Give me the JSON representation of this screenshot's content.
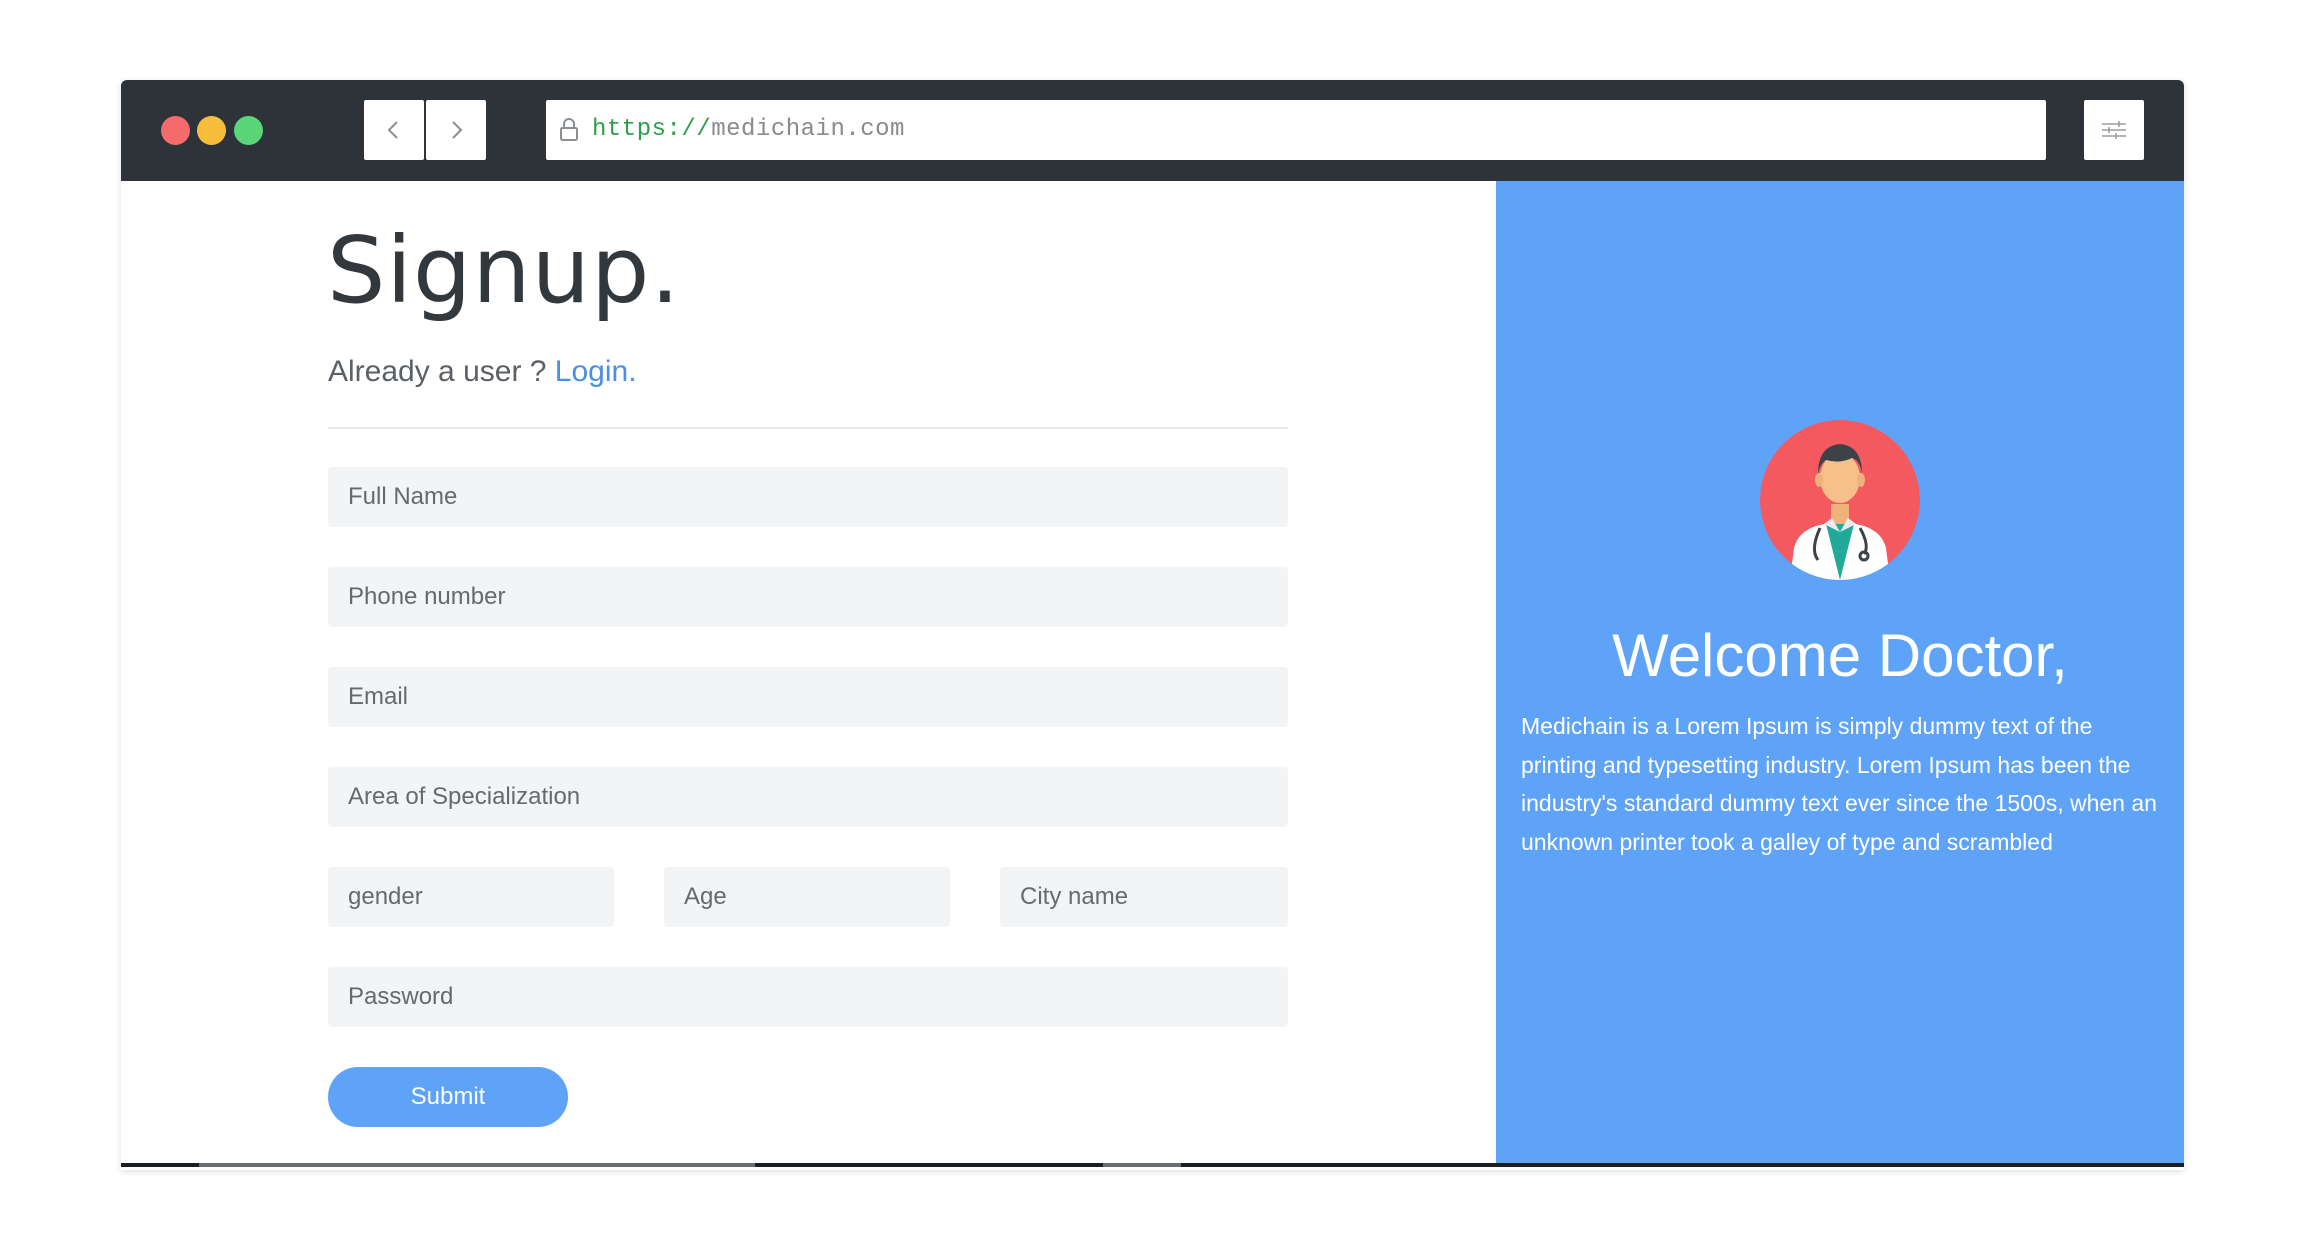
{
  "browser": {
    "url_scheme": "https://",
    "url_host": "medichain.com"
  },
  "signup": {
    "title": "Signup.",
    "already_user": "Already a user ? ",
    "login_link": "Login."
  },
  "form": {
    "full_name_placeholder": "Full Name",
    "phone_placeholder": "Phone number",
    "email_placeholder": "Email",
    "specialization_placeholder": "Area of Specialization",
    "gender_placeholder": "gender",
    "age_placeholder": "Age",
    "city_placeholder": "City name",
    "password_placeholder": "Password",
    "submit_label": "Submit"
  },
  "welcome": {
    "heading": "Welcome Doctor,",
    "description": "Medichain is a Lorem Ipsum is simply dummy text of the printing and typesetting industry. Lorem Ipsum has been the industry's standard dummy text ever since the 1500s, when an unknown printer took a galley of type and scrambled"
  },
  "icons": {
    "window_controls": [
      "close-dot",
      "minimize-dot",
      "maximize-dot"
    ],
    "nav": [
      "chevron-left-icon",
      "chevron-right-icon"
    ],
    "lock": "lock-icon",
    "settings": "sliders-icon",
    "avatar": "doctor-avatar-icon"
  },
  "colors": {
    "accent": "#5ea3f8",
    "titlebar": "#2d3338",
    "link": "#4a8fe7",
    "url_scheme": "#2e9e48",
    "avatar_bg": "#f4595f"
  }
}
